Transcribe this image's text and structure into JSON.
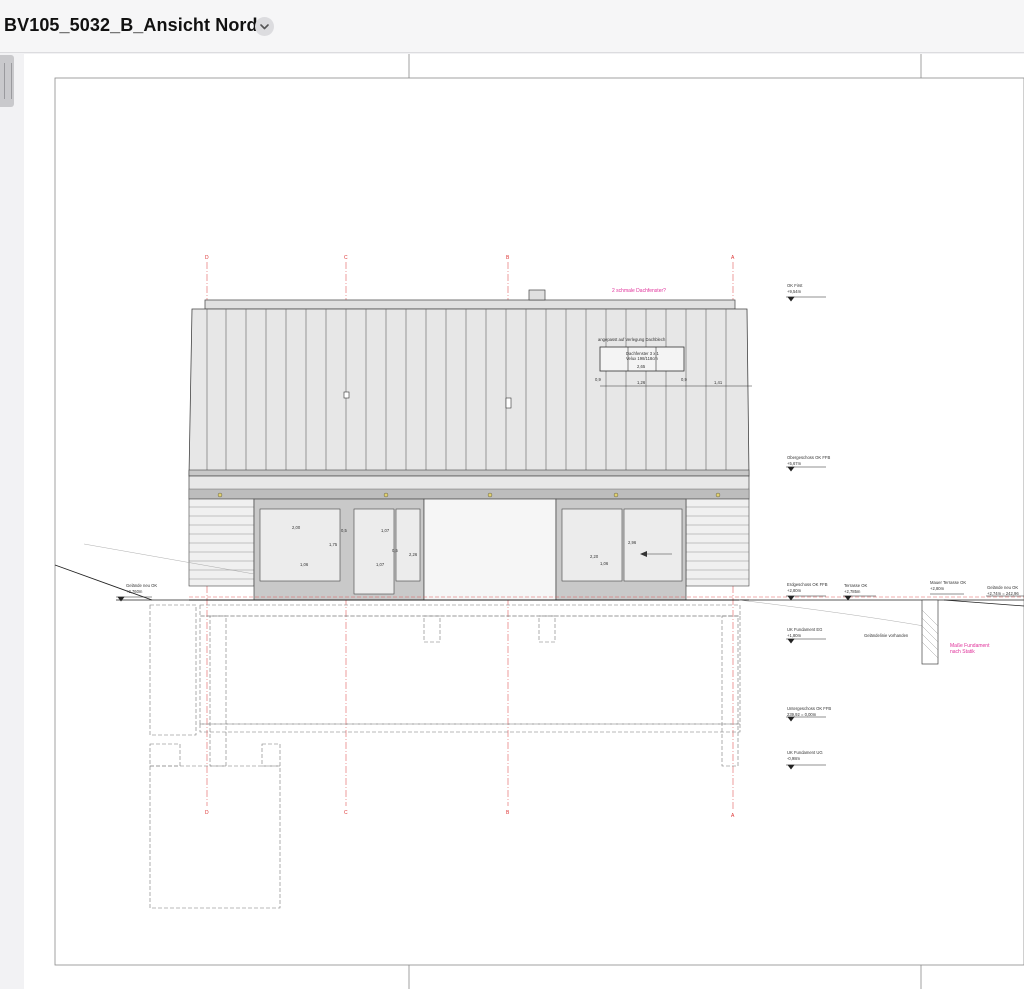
{
  "window": {
    "title": "BV105_5032_B_Ansicht Nord",
    "title_menu_icon": "chevron-down-icon"
  },
  "drawing": {
    "axes": [
      "D",
      "C",
      "B",
      "A"
    ],
    "notes": {
      "roof_windows": "2 schmale Dachfenster?",
      "roof_adjust": "angepasst auf Verlegung Dachblech",
      "skylight_line1": "Dachfenster 3 x 1",
      "skylight_line2": "Velux 198/118cm",
      "foundation": "Maße Fundament",
      "foundation2": "nach Statik",
      "terrain_existing": "Geländelinie vorhanden"
    },
    "levels": {
      "ok_first": "OK First",
      "ok_first_val": "+9,54m",
      "og_ffb": "Obergeschoss OK FFB",
      "og_ffb_val": "+5,67m",
      "eg_ffb": "Erdgeschoss OK FFB",
      "eg_ffb_val": "+2,80m",
      "terrasse": "Terrasse OK",
      "terrasse_val": "+2,785m",
      "mauer": "Mauer Terrasse OK",
      "mauer_val": "+2,80m",
      "gelaende_right": "Gelände neu OK",
      "gelaende_right_val": "+2,74m = 242,96",
      "gelaende_left": "Gelände neu OK",
      "gelaende_left_val": "+2,760m",
      "uk_fund_eg": "UK Fundament EG",
      "uk_fund_eg_val": "+1,80m",
      "ug_ffb": "Untergeschoss OK FFB",
      "ug_ffb_val": "239,92 = 0,00m",
      "uk_fund_ug": "UK Fundament UG",
      "uk_fund_ug_val": "-0,98m"
    },
    "dims": {
      "roof_a": "0,9",
      "roof_b": "1,26",
      "roof_c": "0,9",
      "roof_d": "1,41",
      "skylight_w": "2,65",
      "win1_w": "2,00",
      "win1_h": "1,75",
      "win1_sill": "1,06",
      "door_top": "1,07",
      "door_w": "1,07",
      "door_gap": "0,5",
      "door_h": "2,26",
      "door_x": "0,5",
      "win2_h": "2,20",
      "win2_w": "2,96",
      "win2_sill": "1,06"
    }
  }
}
